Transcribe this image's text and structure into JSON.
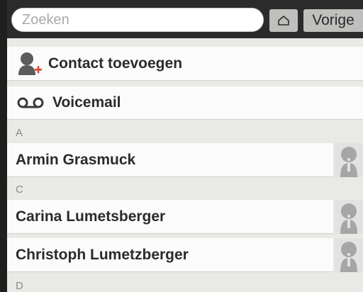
{
  "search": {
    "placeholder": "Zoeken"
  },
  "header": {
    "home_icon": "home-icon",
    "back_label": "Vorige"
  },
  "actions": {
    "add_contact": {
      "label": "Contact toevoegen",
      "icon": "person-add-icon"
    },
    "voicemail": {
      "label": "Voicemail",
      "icon": "voicemail-icon"
    }
  },
  "contacts": {
    "section_a": {
      "letter": "A",
      "items": [
        {
          "name": "Armin Grasmuck"
        }
      ]
    },
    "section_c": {
      "letter": "C",
      "items": [
        {
          "name": "Carina Lumetsberger"
        },
        {
          "name": "Christoph Lumetzberger"
        }
      ]
    },
    "section_d": {
      "letter": "D"
    }
  },
  "colors": {
    "accent_plus": "#e0442c",
    "bar": "#2b2b2b",
    "list_bg": "#e9e9e6",
    "row_bg": "#fbfbfb",
    "info_icon": "#a6a6a6"
  }
}
